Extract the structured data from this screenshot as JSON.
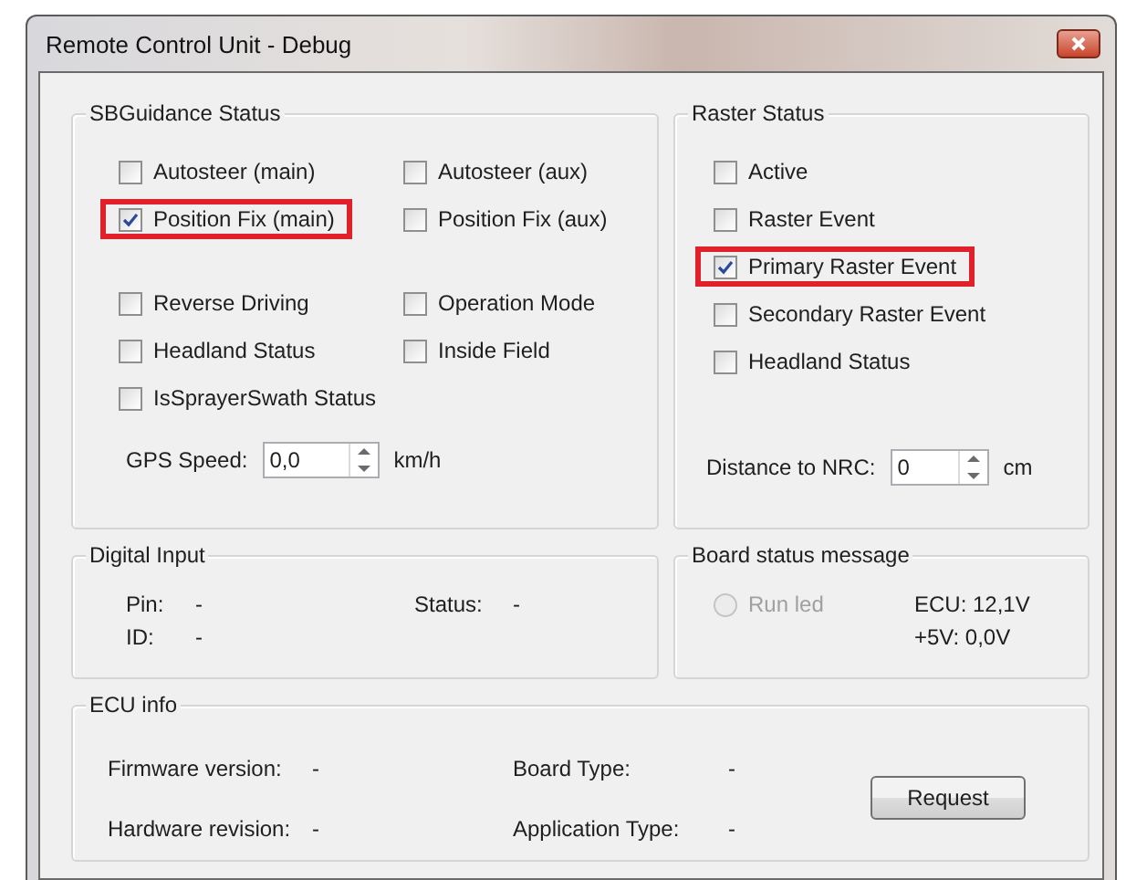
{
  "window": {
    "title": "Remote Control Unit - Debug"
  },
  "sbguidance": {
    "title": "SBGuidance Status",
    "checkbox_groups": [
      [
        {
          "label": "Autosteer (main)",
          "checked": false,
          "highlighted": false
        },
        {
          "label": "Autosteer (aux)",
          "checked": false,
          "highlighted": false
        },
        {
          "label": "Position Fix (main)",
          "checked": true,
          "highlighted": true
        },
        {
          "label": "Position Fix (aux)",
          "checked": false,
          "highlighted": false
        }
      ],
      [
        {
          "label": "Reverse Driving",
          "checked": false,
          "highlighted": false
        },
        {
          "label": "Operation Mode",
          "checked": false,
          "highlighted": false
        },
        {
          "label": "Headland Status",
          "checked": false,
          "highlighted": false
        },
        {
          "label": "Inside Field",
          "checked": false,
          "highlighted": false
        },
        {
          "label": "IsSprayerSwath Status",
          "checked": false,
          "highlighted": false
        }
      ]
    ],
    "gps_speed": {
      "label": "GPS Speed:",
      "value": "0,0",
      "unit": "km/h"
    }
  },
  "raster": {
    "title": "Raster Status",
    "checkboxes": [
      {
        "label": "Active",
        "checked": false,
        "highlighted": false
      },
      {
        "label": "Raster Event",
        "checked": false,
        "highlighted": false
      },
      {
        "label": "Primary Raster Event",
        "checked": true,
        "highlighted": true
      },
      {
        "label": "Secondary Raster Event",
        "checked": false,
        "highlighted": false
      },
      {
        "label": "Headland Status",
        "checked": false,
        "highlighted": false
      }
    ],
    "distance": {
      "label": "Distance to NRC:",
      "value": "0",
      "unit": "cm"
    }
  },
  "digital_input": {
    "title": "Digital Input",
    "fields": [
      {
        "label": "Pin:",
        "value": "-"
      },
      {
        "label": "Status:",
        "value": "-"
      },
      {
        "label": "ID:",
        "value": "-"
      }
    ]
  },
  "board_status": {
    "title": "Board status message",
    "radio": {
      "label": "Run led",
      "selected": false,
      "disabled": true
    },
    "readings": [
      "ECU: 12,1V",
      "+5V: 0,0V"
    ]
  },
  "ecu_info": {
    "title": "ECU info",
    "fields": [
      {
        "label": "Firmware version:",
        "value": "-"
      },
      {
        "label": "Board Type:",
        "value": "-"
      },
      {
        "label": "Hardware revision:",
        "value": "-"
      },
      {
        "label": "Application Type:",
        "value": "-"
      }
    ],
    "button": "Request"
  }
}
